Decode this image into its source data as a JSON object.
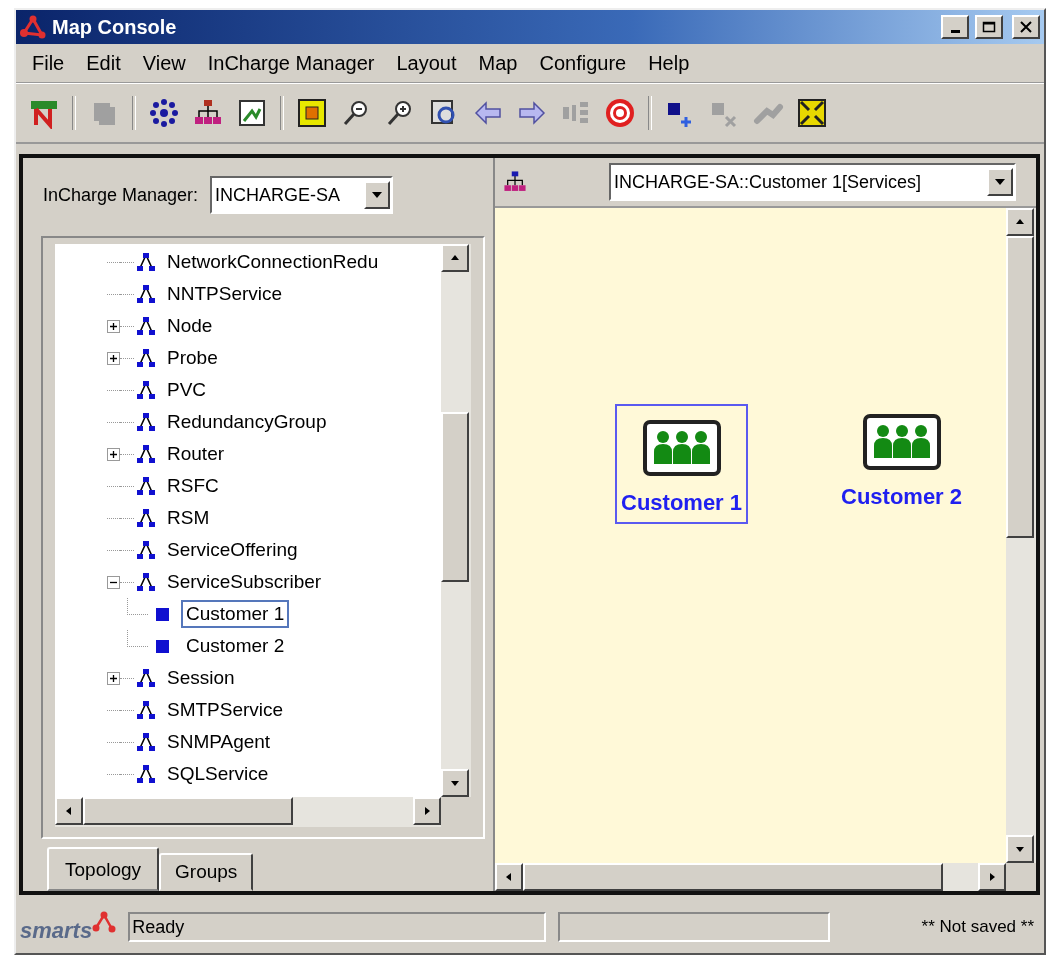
{
  "window": {
    "title": "Map Console"
  },
  "menu": [
    "File",
    "Edit",
    "View",
    "InCharge Manager",
    "Layout",
    "Map",
    "Configure",
    "Help"
  ],
  "toolbar": [
    {
      "kind": "new-topology",
      "disabled": false
    },
    {
      "kind": "separator"
    },
    {
      "kind": "copy",
      "disabled": true
    },
    {
      "kind": "separator"
    },
    {
      "kind": "ring-cluster",
      "disabled": false
    },
    {
      "kind": "hierarchy",
      "disabled": false
    },
    {
      "kind": "frame",
      "disabled": false
    },
    {
      "kind": "separator"
    },
    {
      "kind": "fit",
      "disabled": false
    },
    {
      "kind": "zoom-out",
      "disabled": false
    },
    {
      "kind": "zoom-in",
      "disabled": false
    },
    {
      "kind": "refresh",
      "disabled": false
    },
    {
      "kind": "back",
      "disabled": false
    },
    {
      "kind": "forward",
      "disabled": false
    },
    {
      "kind": "split",
      "disabled": true
    },
    {
      "kind": "target",
      "disabled": false
    },
    {
      "kind": "separator"
    },
    {
      "kind": "add-node",
      "disabled": false
    },
    {
      "kind": "delete-node",
      "disabled": true
    },
    {
      "kind": "link",
      "disabled": true
    },
    {
      "kind": "expand-all",
      "disabled": false
    }
  ],
  "manager": {
    "label": "InCharge Manager:",
    "value": "INCHARGE-SA"
  },
  "tree": [
    {
      "kind": "class",
      "label": "NetworkConnectionRedu",
      "selected": false
    },
    {
      "kind": "class",
      "label": "NNTPService",
      "selected": false
    },
    {
      "kind": "class",
      "label": "Node",
      "selected": false,
      "expanded": false
    },
    {
      "kind": "class",
      "label": "Probe",
      "selected": false,
      "expanded": false
    },
    {
      "kind": "class",
      "label": "PVC",
      "selected": false
    },
    {
      "kind": "class",
      "label": "RedundancyGroup",
      "selected": false
    },
    {
      "kind": "class",
      "label": "Router",
      "selected": false,
      "expanded": false
    },
    {
      "kind": "class",
      "label": "RSFC",
      "selected": false
    },
    {
      "kind": "class",
      "label": "RSM",
      "selected": false
    },
    {
      "kind": "class",
      "label": "ServiceOffering",
      "selected": false
    },
    {
      "kind": "class",
      "label": "ServiceSubscriber",
      "selected": false,
      "expanded": true,
      "children": [
        {
          "kind": "instance",
          "label": "Customer 1",
          "selected": true
        },
        {
          "kind": "instance",
          "label": "Customer 2",
          "selected": false
        }
      ]
    },
    {
      "kind": "class",
      "label": "Session",
      "selected": false,
      "expanded": false
    },
    {
      "kind": "class",
      "label": "SMTPService",
      "selected": false
    },
    {
      "kind": "class",
      "label": "SNMPAgent",
      "selected": false
    },
    {
      "kind": "class",
      "label": "SQLService",
      "selected": false
    }
  ],
  "tabs": [
    {
      "label": "Topology",
      "selected": true
    },
    {
      "label": "Groups",
      "selected": false
    }
  ],
  "map": {
    "view": "INCHARGE-SA::Customer 1[Services]",
    "nodes": [
      {
        "label": "Customer 1",
        "selected": true
      },
      {
        "label": "Customer 2",
        "selected": false
      }
    ]
  },
  "status_bar": {
    "logo": "smarts",
    "message": "Ready",
    "save_state": "** Not saved **"
  }
}
